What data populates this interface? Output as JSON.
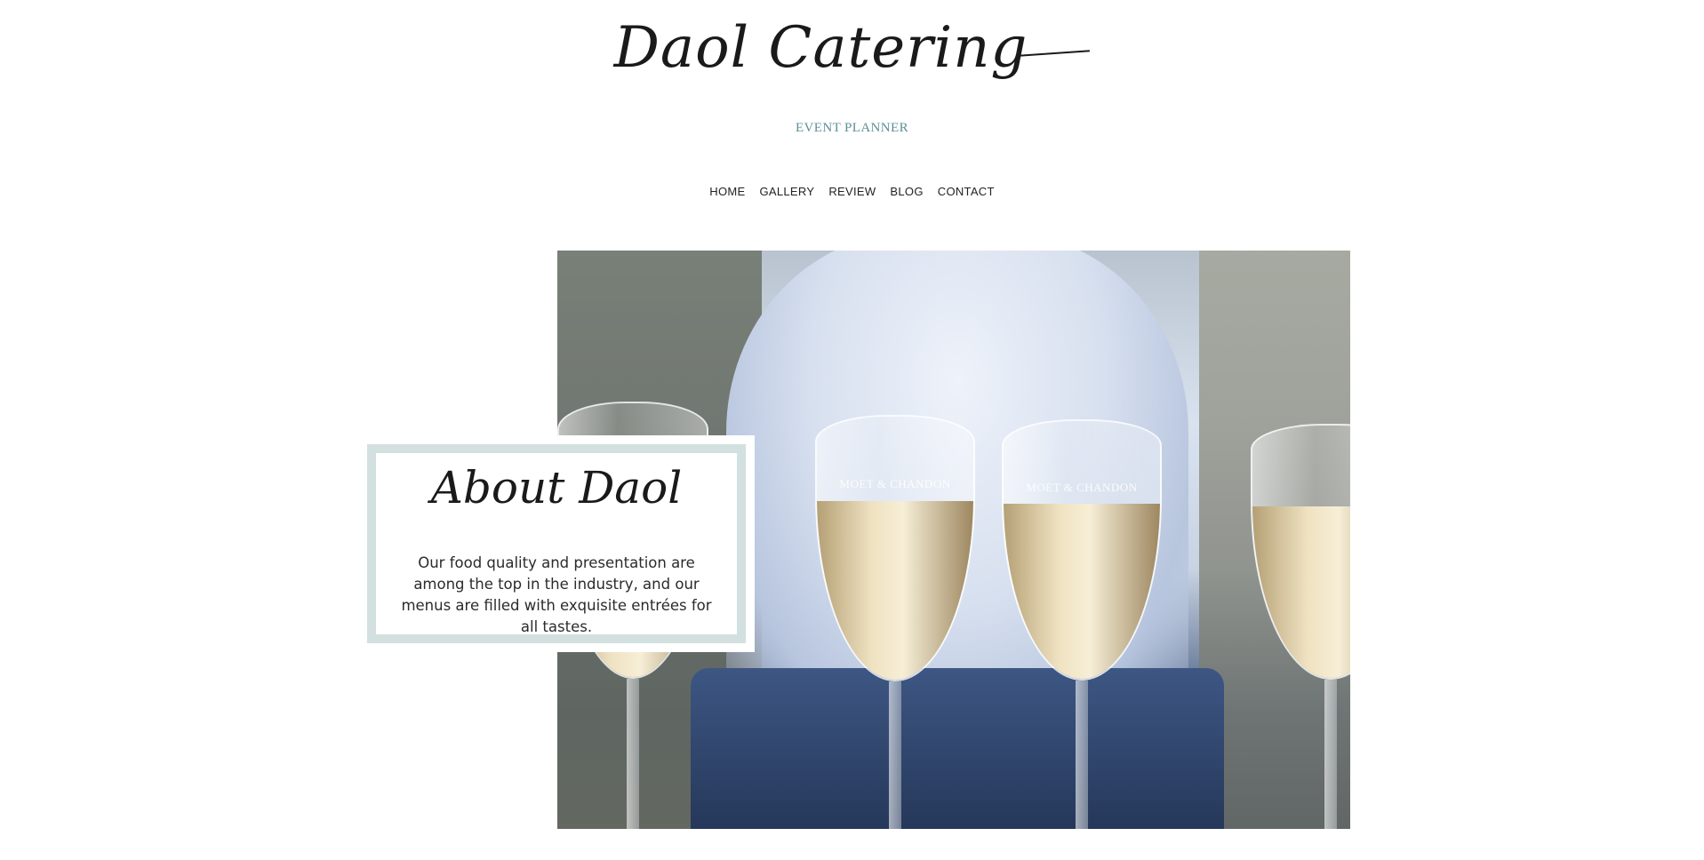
{
  "header": {
    "logo_text": "Daol Catering",
    "tagline": "EVENT PLANNER"
  },
  "nav": {
    "items": [
      {
        "label": "HOME"
      },
      {
        "label": "GALLERY"
      },
      {
        "label": "REVIEW"
      },
      {
        "label": "BLOG"
      },
      {
        "label": "CONTACT"
      }
    ]
  },
  "hero": {
    "image_subject": "champagne-glasses",
    "glass_label": "MOET & CHANDON"
  },
  "about": {
    "title": "About Daol",
    "text": "Our food quality and presentation are among the top in the industry, and our menus are filled with exquisite entrées for all tastes."
  },
  "colors": {
    "tagline": "#5e9096",
    "frame": "#d3e0e0",
    "text": "#2b2b2b"
  }
}
